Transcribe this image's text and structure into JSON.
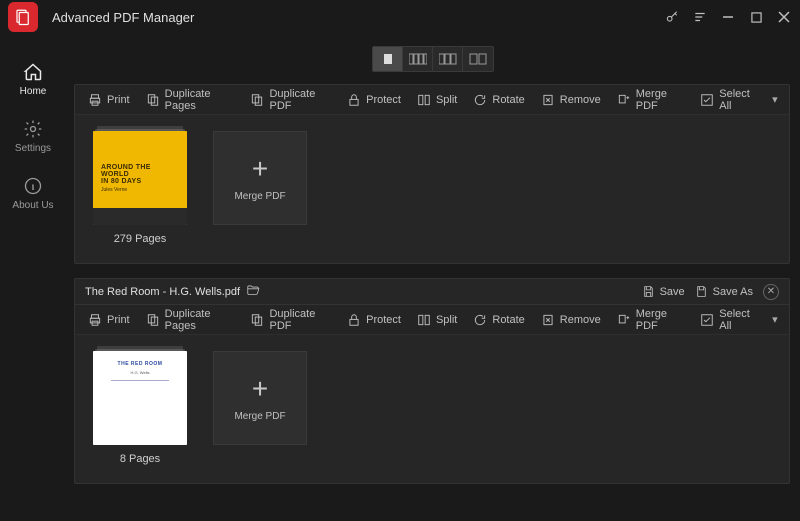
{
  "app": {
    "title": "Advanced PDF Manager"
  },
  "sidebar": {
    "items": [
      {
        "label": "Home",
        "icon": "home-icon",
        "active": true
      },
      {
        "label": "Settings",
        "icon": "gear-icon",
        "active": false
      },
      {
        "label": "About Us",
        "icon": "info-icon",
        "active": false
      }
    ]
  },
  "toolbar": {
    "print": "Print",
    "duplicate_pages": "Duplicate Pages",
    "duplicate_pdf": "Duplicate PDF",
    "protect": "Protect",
    "split": "Split",
    "rotate": "Rotate",
    "remove": "Remove",
    "merge_pdf": "Merge PDF",
    "select_all": "Select All"
  },
  "header_buttons": {
    "save": "Save",
    "save_as": "Save As"
  },
  "merge_tile_label": "Merge PDF",
  "documents": [
    {
      "filename": "",
      "page_count_label": "279 Pages",
      "cover": {
        "type": "yellow",
        "title": "Around the World",
        "subtitle": "in 80 Days",
        "author": "Jules Verne"
      },
      "show_header": false
    },
    {
      "filename": "The Red Room - H.G. Wells.pdf",
      "page_count_label": "8 Pages",
      "cover": {
        "type": "white",
        "title": "THE RED ROOM",
        "author": "H.G. Wells"
      },
      "show_header": true
    }
  ]
}
